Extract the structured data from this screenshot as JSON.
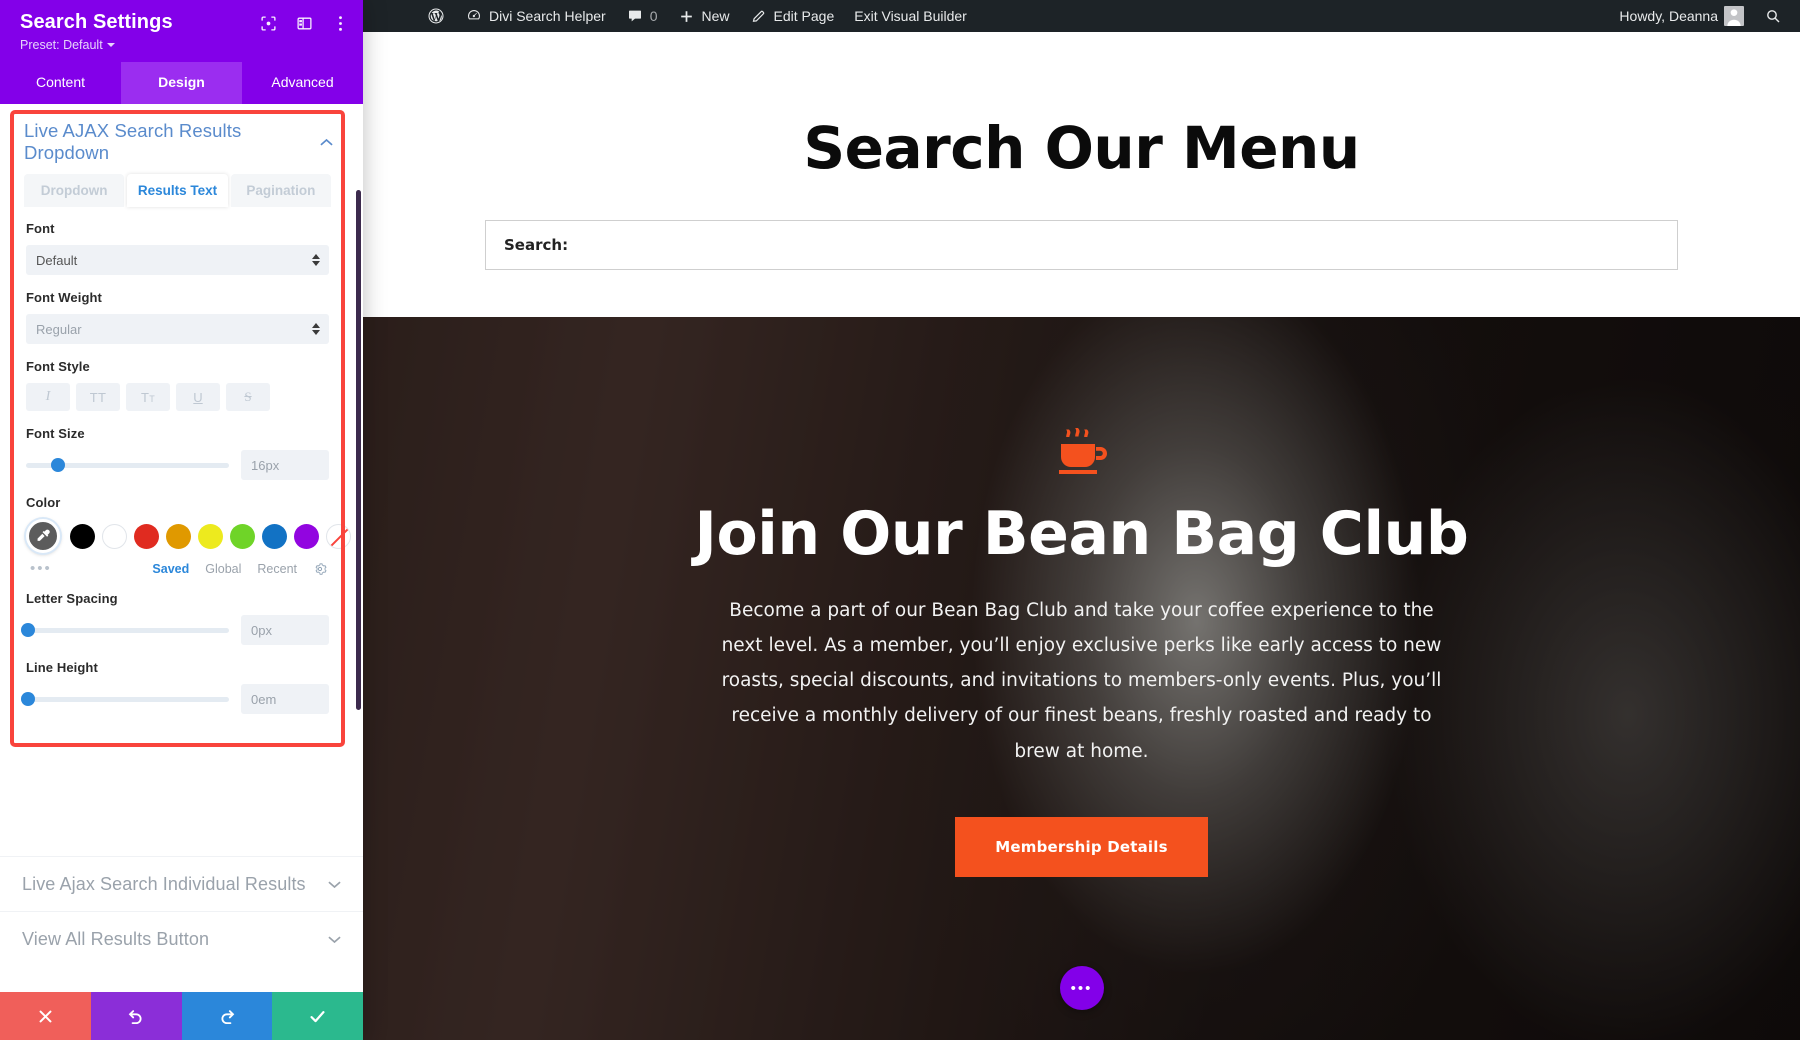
{
  "adminbar": {
    "wp_logo": "wordpress-logo-icon",
    "site_name": "Divi Search Helper",
    "comments_count": "0",
    "new_label": "New",
    "edit_page_label": "Edit Page",
    "exit_builder_label": "Exit Visual Builder",
    "howdy": "Howdy, Deanna",
    "search_icon": "search-icon"
  },
  "panel": {
    "title": "Search Settings",
    "preset_label": "Preset: Default",
    "header_icons": [
      "focus-target-icon",
      "layout-columns-icon",
      "kebab-menu-icon"
    ],
    "tabs": [
      {
        "label": "Content",
        "active": false
      },
      {
        "label": "Design",
        "active": true
      },
      {
        "label": "Advanced",
        "active": false
      }
    ],
    "open_section": {
      "title": "Live AJAX Search Results Dropdown",
      "chevron": "chevron-up-icon",
      "subtabs": [
        {
          "label": "Dropdown",
          "active": false
        },
        {
          "label": "Results Text",
          "active": true
        },
        {
          "label": "Pagination",
          "active": false
        }
      ],
      "font": {
        "label": "Font",
        "value": "Default"
      },
      "font_weight": {
        "label": "Font Weight",
        "value": "Regular"
      },
      "font_style": {
        "label": "Font Style",
        "buttons": [
          {
            "name": "italic-button",
            "glyph": "I"
          },
          {
            "name": "uppercase-button",
            "glyph": "TT"
          },
          {
            "name": "small-caps-button",
            "glyph": "T"
          },
          {
            "name": "underline-button",
            "glyph": "U"
          },
          {
            "name": "strikethrough-button",
            "glyph": "S"
          }
        ]
      },
      "font_size": {
        "label": "Font Size",
        "value": "16px",
        "knob_pct": 16
      },
      "color": {
        "label": "Color",
        "picker_icon": "eyedropper-icon",
        "swatches": [
          {
            "name": "black",
            "hex": "#000000"
          },
          {
            "name": "white",
            "hex": "#ffffff"
          },
          {
            "name": "red",
            "hex": "#e02b20"
          },
          {
            "name": "orange",
            "hex": "#e09900"
          },
          {
            "name": "yellow",
            "hex": "#edea1e"
          },
          {
            "name": "green",
            "hex": "#6fd428"
          },
          {
            "name": "blue",
            "hex": "#1272c4"
          },
          {
            "name": "purple",
            "hex": "#9205e0"
          },
          {
            "name": "transparent",
            "hex": "transparent"
          }
        ],
        "more_dots": "•••",
        "links": [
          {
            "label": "Saved",
            "active": true
          },
          {
            "label": "Global",
            "active": false
          },
          {
            "label": "Recent",
            "active": false
          }
        ],
        "gear": "gear-icon"
      },
      "letter_spacing": {
        "label": "Letter Spacing",
        "value": "0px",
        "knob_pct": 1
      },
      "line_height": {
        "label": "Line Height",
        "value": "0em",
        "knob_pct": 1
      }
    },
    "closed_sections": [
      {
        "title": "Live Ajax Search Individual Results",
        "chevron": "chevron-down-icon"
      },
      {
        "title": "View All Results Button",
        "chevron": "chevron-down-icon"
      }
    ],
    "actions": [
      {
        "name": "cancel-button",
        "icon": "close-icon",
        "color": "#f05f5a"
      },
      {
        "name": "undo-button",
        "icon": "undo-icon",
        "color": "#8b2ed8"
      },
      {
        "name": "redo-button",
        "icon": "redo-icon",
        "color": "#2b87da"
      },
      {
        "name": "save-button",
        "icon": "check-icon",
        "color": "#2bb98e"
      }
    ]
  },
  "page": {
    "heading": "Search Our Menu",
    "search_label": "Search:",
    "search_placeholder": "",
    "hero": {
      "icon": "coffee-cup-icon",
      "title": "Join Our Bean Bag Club",
      "body": "Become a part of our Bean Bag Club and take your coffee experience to the next level. As a member, you’ll enjoy exclusive perks like early access to new roasts, special discounts, and invitations to members-only events. Plus, you’ll receive a monthly delivery of our finest beans, freshly roasted and ready to brew at home.",
      "cta": "Membership Details"
    },
    "fab": "•••"
  },
  "colors": {
    "brand_purple": "#8300e9",
    "accent_blue": "#2b87da",
    "highlight_red": "#f9443c",
    "cta_orange": "#f4511e"
  }
}
